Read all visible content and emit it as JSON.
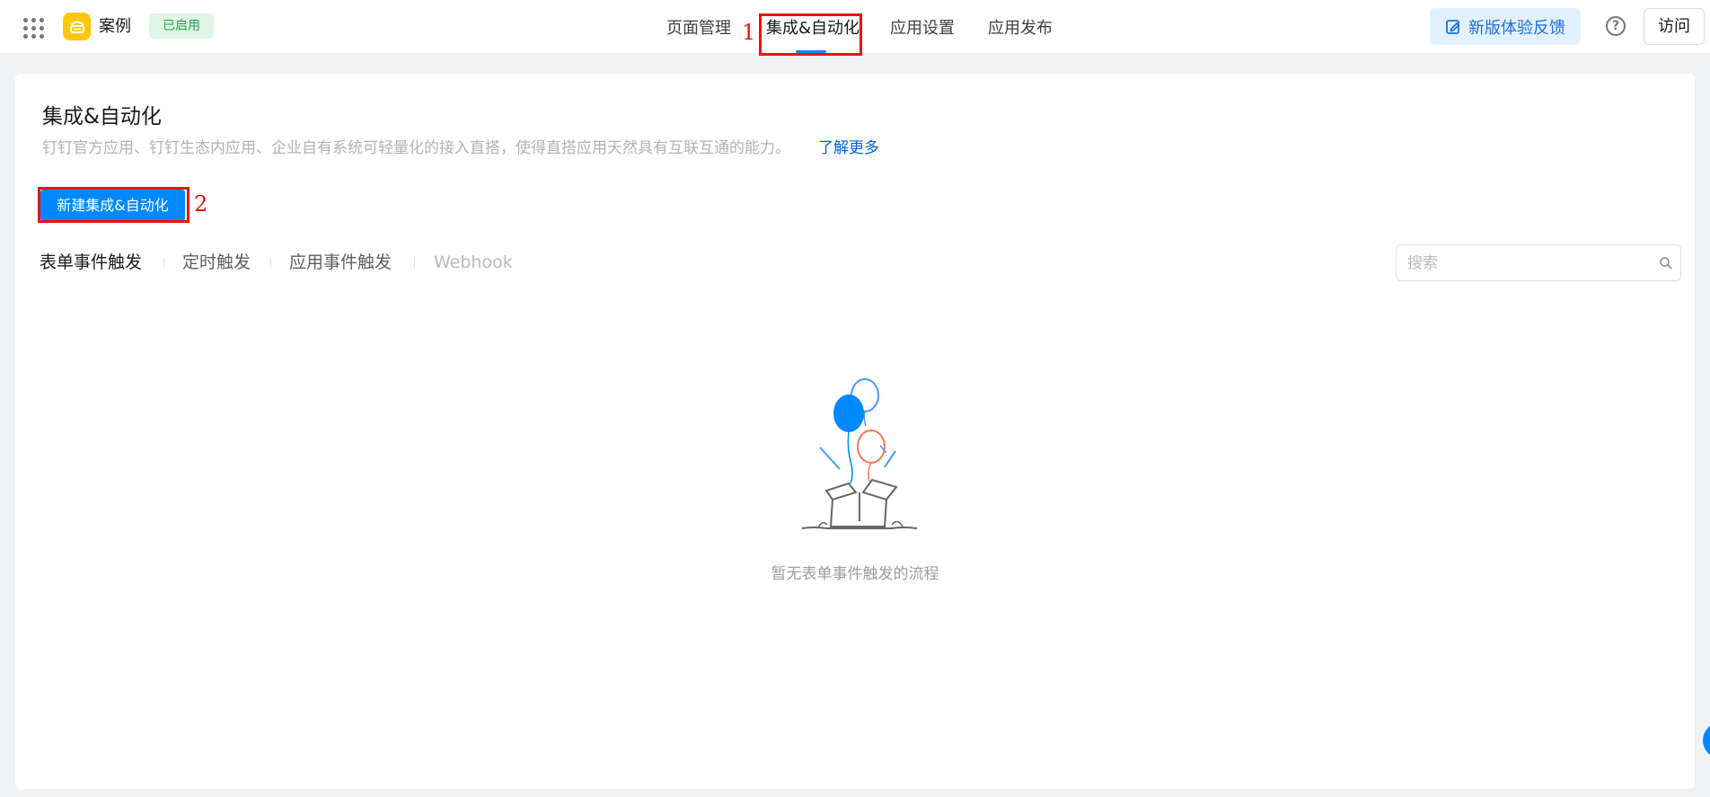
{
  "header": {
    "app_name": "案例",
    "status_badge": "已启用",
    "tabs": [
      {
        "label": "页面管理",
        "active": false
      },
      {
        "label": "集成&自动化",
        "active": true
      },
      {
        "label": "应用设置",
        "active": false
      },
      {
        "label": "应用发布",
        "active": false
      }
    ],
    "feedback_label": "新版体验反馈",
    "visit_label": "访问",
    "icons": {
      "apps": "grid-dots-icon",
      "logo": "app-logo-icon",
      "feedback": "edit-note-icon",
      "help": "question-circle-icon"
    }
  },
  "annotations": {
    "first": "1",
    "second": "2"
  },
  "main": {
    "title": "集成&自动化",
    "description": "钉钉官方应用、钉钉生态内应用、企业自有系统可轻量化的接入直搭，使得直搭应用天然具有互联互通的能力。",
    "learn_more": "了解更多",
    "new_button": "新建集成&自动化",
    "sub_tabs": [
      {
        "label": "表单事件触发",
        "state": "active"
      },
      {
        "label": "定时触发",
        "state": "normal"
      },
      {
        "label": "应用事件触发",
        "state": "normal"
      },
      {
        "label": "Webhook",
        "state": "disabled"
      }
    ],
    "search_placeholder": "搜索",
    "empty_text": "暂无表单事件触发的流程"
  },
  "colors": {
    "accent": "#0089ff",
    "annotation": "#ee1111",
    "badge_bg": "#dff5e6",
    "badge_text": "#24a44b",
    "logo": "#ffc60a"
  }
}
